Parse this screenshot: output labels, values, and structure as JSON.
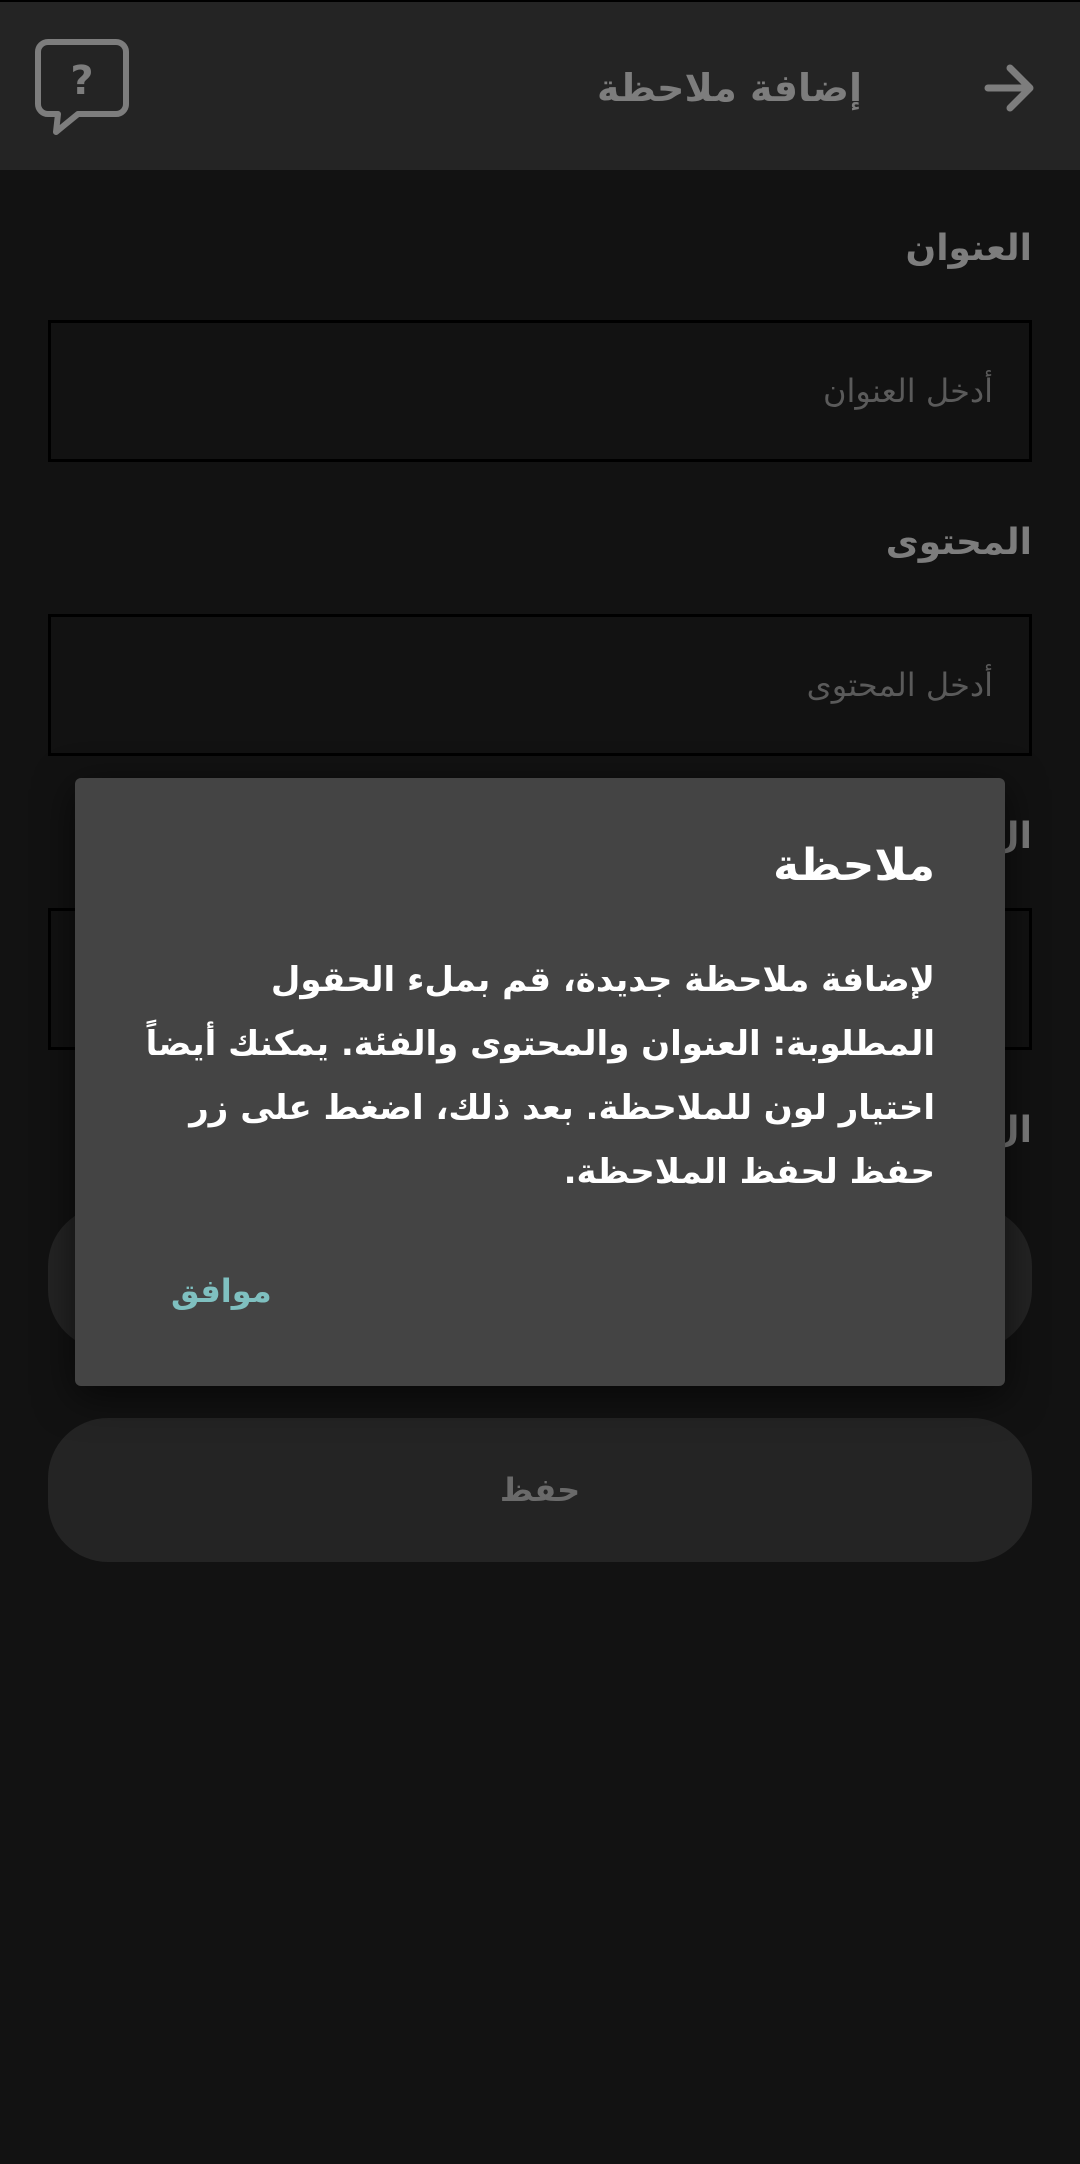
{
  "appbar": {
    "title": "إضافة ملاحظة"
  },
  "form": {
    "title_label": "العنوان",
    "title_placeholder": "أدخل العنوان",
    "content_label": "المحتوى",
    "content_placeholder": "أدخل المحتوى",
    "save_label": "حفظ"
  },
  "dialog": {
    "title": "ملاحظة",
    "body": "لإضافة ملاحظة جديدة، قم بملء الحقول المطلوبة: العنوان والمحتوى والفئة. يمكنك أيضاً اختيار لون للملاحظة. بعد ذلك، اضغط على زر حفظ لحفظ الملاحظة.",
    "ok_label": "موافق"
  },
  "colors": {
    "background": "#121212",
    "appbar": "#242424",
    "dialog": "#444444",
    "accent": "#7fc0c0"
  },
  "icons": {
    "back": "arrow-right-icon",
    "help": "question-bubble-icon"
  }
}
